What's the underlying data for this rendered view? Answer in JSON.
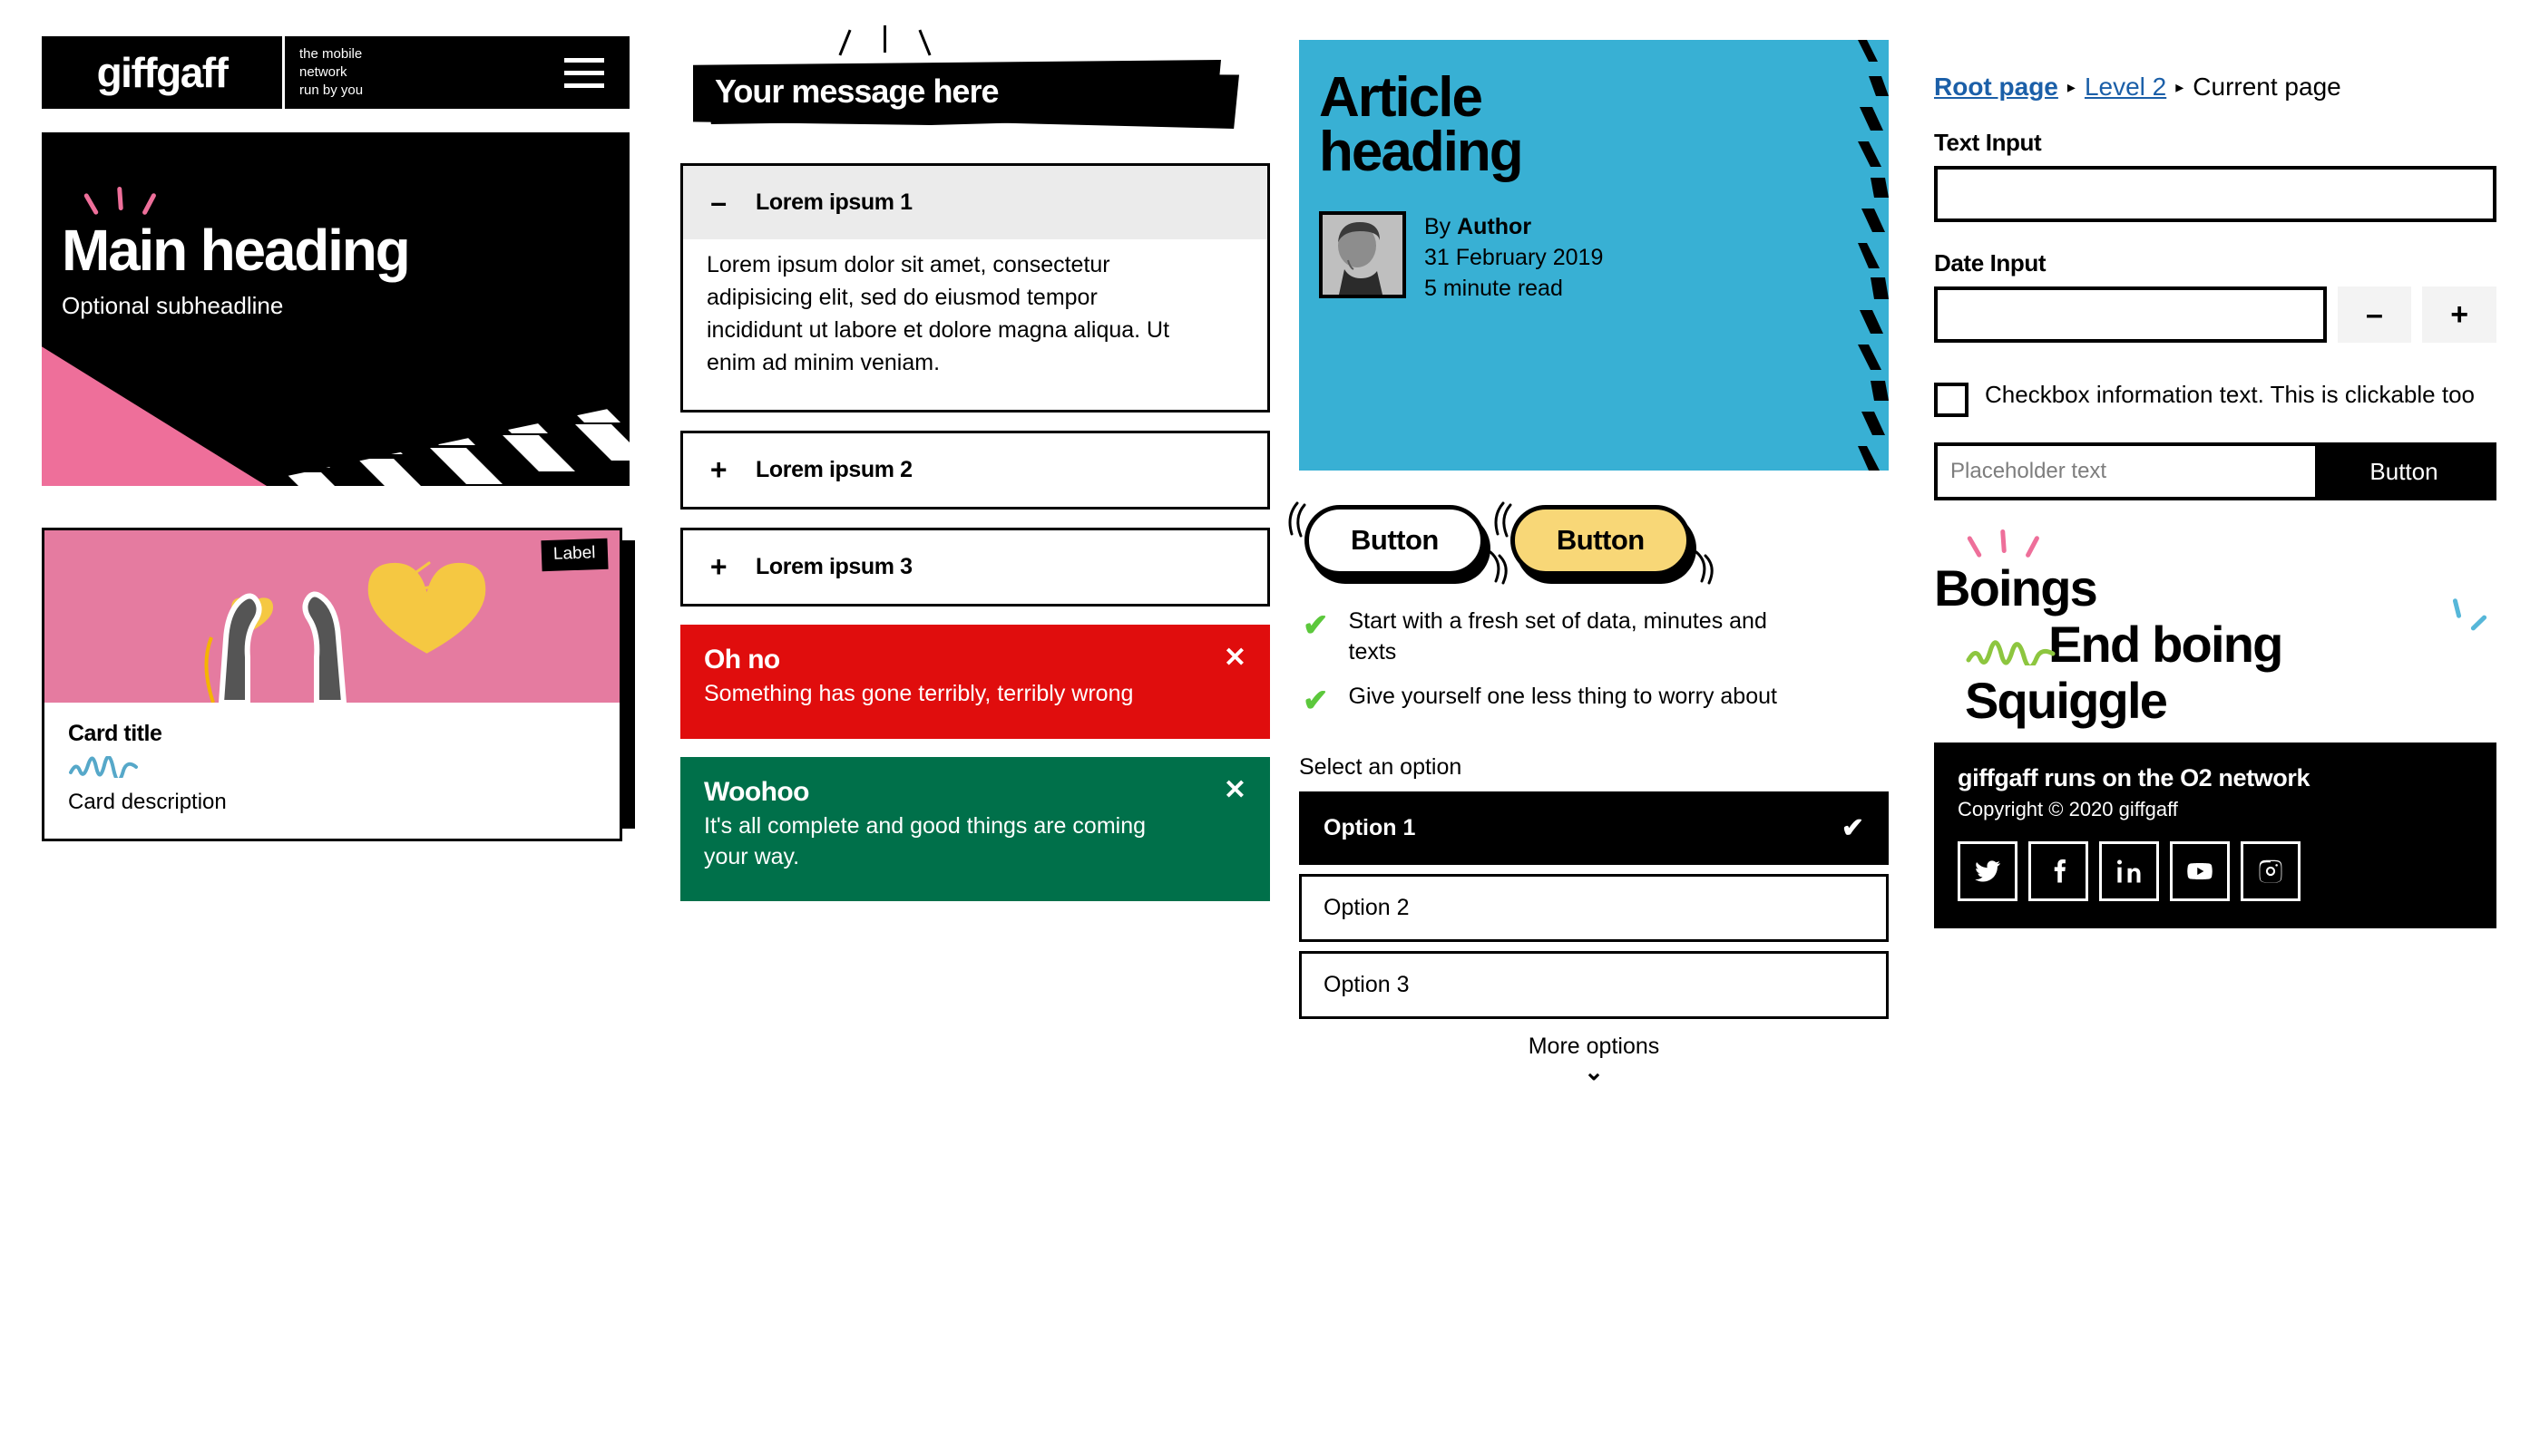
{
  "brand": {
    "logo_text": "giffgaff",
    "tagline_line1": "the mobile",
    "tagline_line2": "network",
    "tagline_line3": "run by you",
    "menu_icon": "hamburger-menu-icon"
  },
  "colors": {
    "pink": "#ee6f9a",
    "card_pink": "#e57ba0",
    "cyan": "#38b0d4",
    "yellow": "#f8d777",
    "green_tick": "#5cc83c",
    "error_red": "#e00d0d",
    "success_green": "#00704a",
    "link_blue": "#1b5fa8",
    "squiggle_blue": "#56a8c9",
    "squiggle_green": "#8dc63f",
    "heart_yellow": "#f5c842"
  },
  "hero": {
    "heading": "Main heading",
    "subheadline": "Optional subheadline"
  },
  "card": {
    "label": "Label",
    "title": "Card title",
    "description": "Card description"
  },
  "message_banner": {
    "text": "Your message here"
  },
  "accordion": {
    "items": [
      {
        "sign": "–",
        "label": "Lorem ipsum 1",
        "open": true,
        "body": "Lorem ipsum dolor sit amet, consectetur adipisicing elit, sed do eiusmod tempor incididunt ut labore et dolore magna aliqua. Ut enim ad minim veniam."
      },
      {
        "sign": "+",
        "label": "Lorem ipsum 2",
        "open": false,
        "body": ""
      },
      {
        "sign": "+",
        "label": "Lorem ipsum 3",
        "open": false,
        "body": ""
      }
    ]
  },
  "alerts": [
    {
      "type": "error",
      "title": "Oh no",
      "message": "Something has gone terribly, terribly wrong",
      "close": "✕"
    },
    {
      "type": "success",
      "title": "Woohoo",
      "message": "It's all complete and good things are coming your way.",
      "close": "✕"
    }
  ],
  "article": {
    "heading": "Article heading",
    "by_prefix": "By ",
    "author": "Author",
    "date": "31 February 2019",
    "read_time": "5 minute read"
  },
  "buttons": {
    "secondary_label": "Button",
    "primary_label": "Button"
  },
  "ticks": [
    {
      "icon": "check-icon",
      "text": "Start with a fresh set of data, minutes and texts"
    },
    {
      "icon": "check-icon",
      "text": "Give yourself one less thing to worry about"
    }
  ],
  "select": {
    "label": "Select an option",
    "options": [
      {
        "label": "Option 1",
        "selected": true,
        "check": "✔"
      },
      {
        "label": "Option 2",
        "selected": false,
        "check": ""
      },
      {
        "label": "Option 3",
        "selected": false,
        "check": ""
      }
    ],
    "more_label": "More options",
    "more_icon": "chevron-down-icon"
  },
  "breadcrumb": {
    "root": "Root page",
    "level2": "Level 2",
    "current": "Current page",
    "separator": "▸"
  },
  "form": {
    "text_input_label": "Text Input",
    "text_input_value": "",
    "text_input_placeholder": "",
    "date_input_label": "Date Input",
    "date_input_value": "",
    "date_input_placeholder": "",
    "minus_label": "–",
    "plus_label": "+",
    "checkbox_text": "Checkbox information text. This is clickable too",
    "checkbox_checked": false,
    "inline_placeholder": "Placeholder text",
    "inline_value": "",
    "inline_button": "Button"
  },
  "boings": {
    "word1": "Boings",
    "word2": "End boing",
    "word3": "Squiggle"
  },
  "footer": {
    "title": "giffgaff runs on the O2 network",
    "copyright": "Copyright © 2020 giffgaff",
    "socials": [
      {
        "name": "twitter-icon"
      },
      {
        "name": "facebook-icon"
      },
      {
        "name": "linkedin-icon"
      },
      {
        "name": "youtube-icon"
      },
      {
        "name": "instagram-icon"
      }
    ]
  }
}
